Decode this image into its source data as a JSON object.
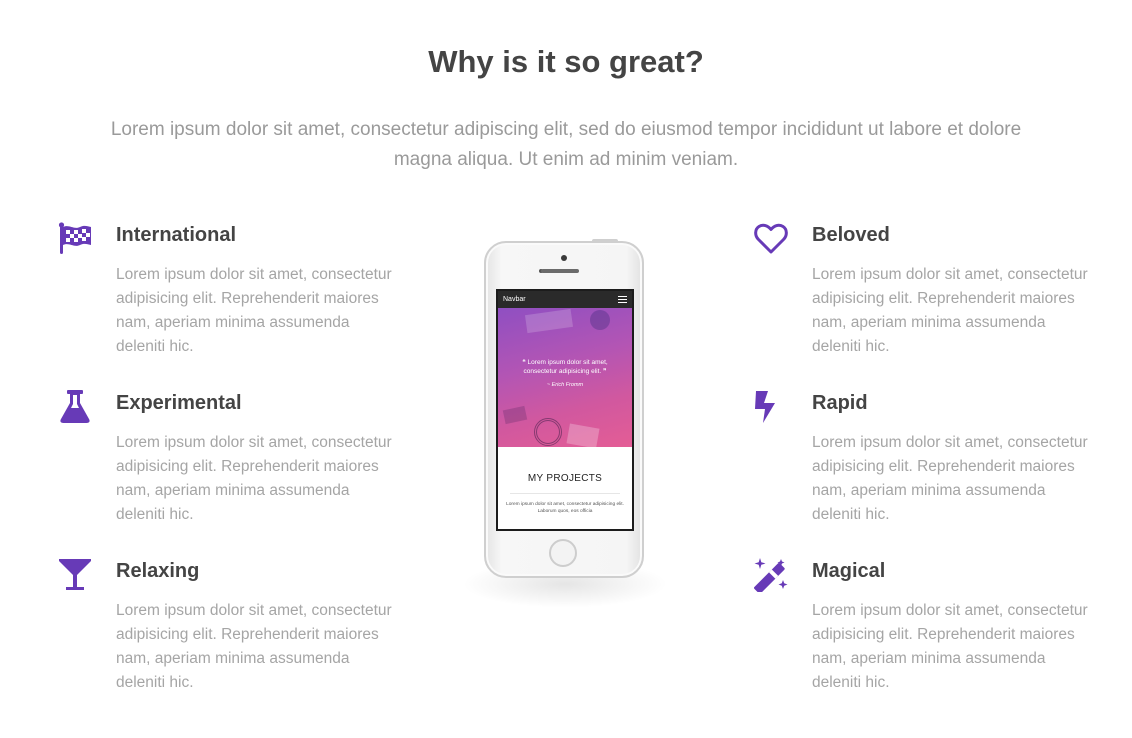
{
  "section": {
    "title": "Why is it so great?",
    "lead": "Lorem ipsum dolor sit amet, consectetur adipiscing elit, sed do eiusmod tempor incididunt ut labore et dolore magna aliqua. Ut enim ad minim veniam."
  },
  "accent_color": "#673ab7",
  "features": [
    {
      "icon": "checkered-flag-icon",
      "title": "International",
      "text": "Lorem ipsum dolor sit amet, consectetur adipisicing elit. Reprehenderit maiores nam, aperiam minima assumenda deleniti hic."
    },
    {
      "icon": "flask-icon",
      "title": "Experimental",
      "text": "Lorem ipsum dolor sit amet, consectetur adipisicing elit. Reprehenderit maiores nam, aperiam minima assumenda deleniti hic."
    },
    {
      "icon": "cocktail-glass-icon",
      "title": "Relaxing",
      "text": "Lorem ipsum dolor sit amet, consectetur adipisicing elit. Reprehenderit maiores nam, aperiam minima assumenda deleniti hic."
    },
    {
      "icon": "heart-icon",
      "title": "Beloved",
      "text": "Lorem ipsum dolor sit amet, consectetur adipisicing elit. Reprehenderit maiores nam, aperiam minima assumenda deleniti hic."
    },
    {
      "icon": "lightning-bolt-icon",
      "title": "Rapid",
      "text": "Lorem ipsum dolor sit amet, consectetur adipisicing elit. Reprehenderit maiores nam, aperiam minima assumenda deleniti hic."
    },
    {
      "icon": "magic-wand-icon",
      "title": "Magical",
      "text": "Lorem ipsum dolor sit amet, consectetur adipisicing elit. Reprehenderit maiores nam, aperiam minima assumenda deleniti hic."
    }
  ],
  "phone": {
    "navbar_label": "Navbar",
    "quote": "Lorem ipsum dolor sit amet, consectetur adipisicing elit.",
    "quote_author": "~ Erich Fromm",
    "projects_heading": "MY PROJECTS",
    "projects_text": "Lorem ipsum dolor sit amet, consectetur adipisicing elit. Laborum quos, eos officia"
  }
}
